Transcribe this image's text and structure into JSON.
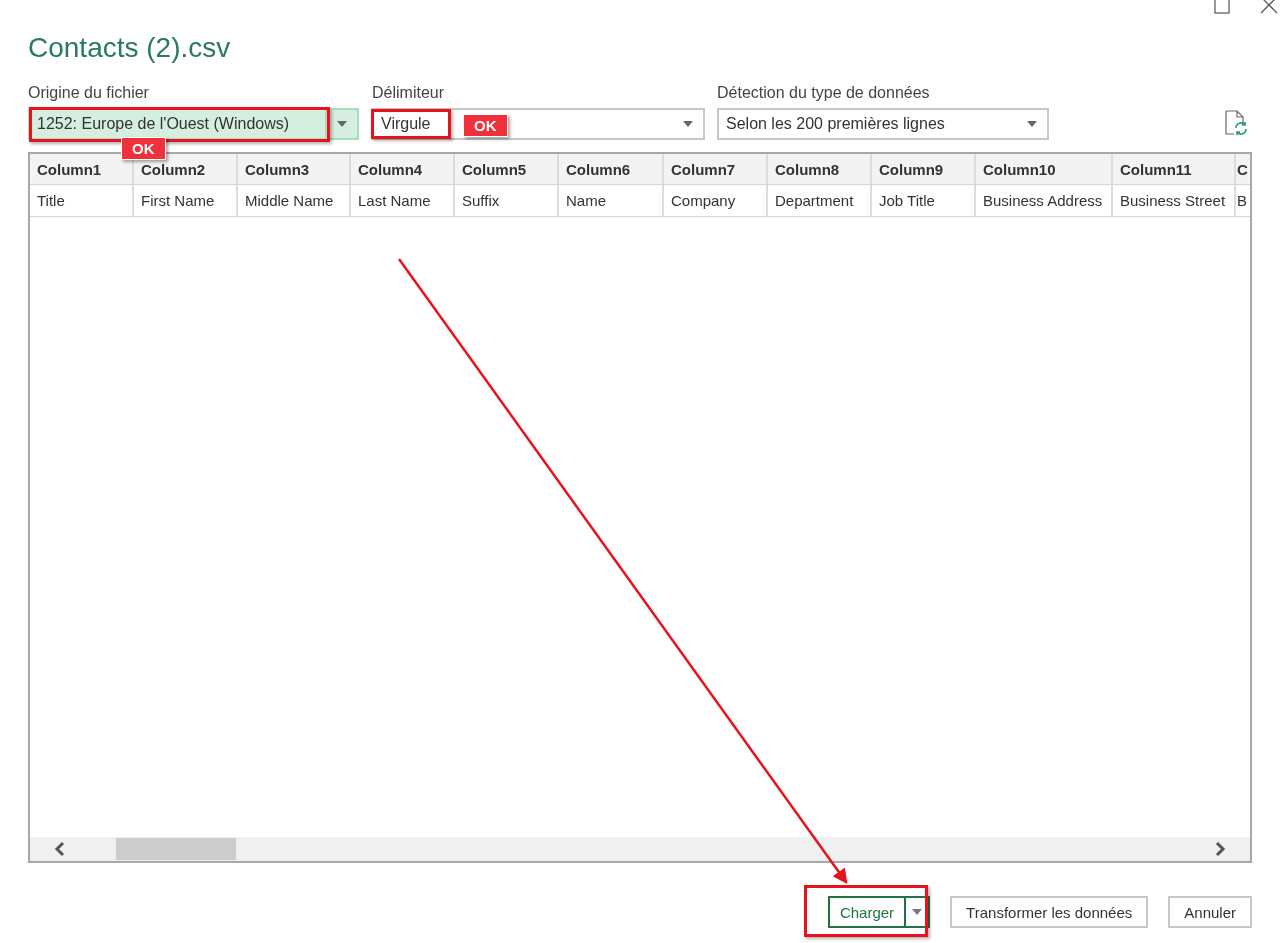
{
  "window": {
    "title": "Contacts (2).csv"
  },
  "fields": [
    {
      "label": "Origine du fichier",
      "value": "1252: Europe de l'Ouest (Windows)",
      "focused": true
    },
    {
      "label": "Délimiteur",
      "value": "Virgule",
      "focused": false
    },
    {
      "label": "Détection du type de données",
      "value": "Selon les 200 premières lignes",
      "focused": false
    }
  ],
  "table": {
    "columns": [
      "Column1",
      "Column2",
      "Column3",
      "Column4",
      "Column5",
      "Column6",
      "Column7",
      "Column8",
      "Column9",
      "Column10",
      "Column11",
      "C"
    ],
    "rows": [
      [
        "Title",
        "First Name",
        "Middle Name",
        "Last Name",
        "Suffix",
        "Name",
        "Company",
        "Department",
        "Job Title",
        "Business Address",
        "Business Street",
        "B"
      ]
    ]
  },
  "buttons": [
    {
      "label": "Charger",
      "kind": "split"
    },
    {
      "label": "Transformer les données",
      "kind": "plain"
    },
    {
      "label": "Annuler",
      "kind": "plain"
    }
  ],
  "annotations": [
    {
      "kind": "badge",
      "text": "OK"
    },
    {
      "kind": "badge",
      "text": "OK"
    }
  ]
}
